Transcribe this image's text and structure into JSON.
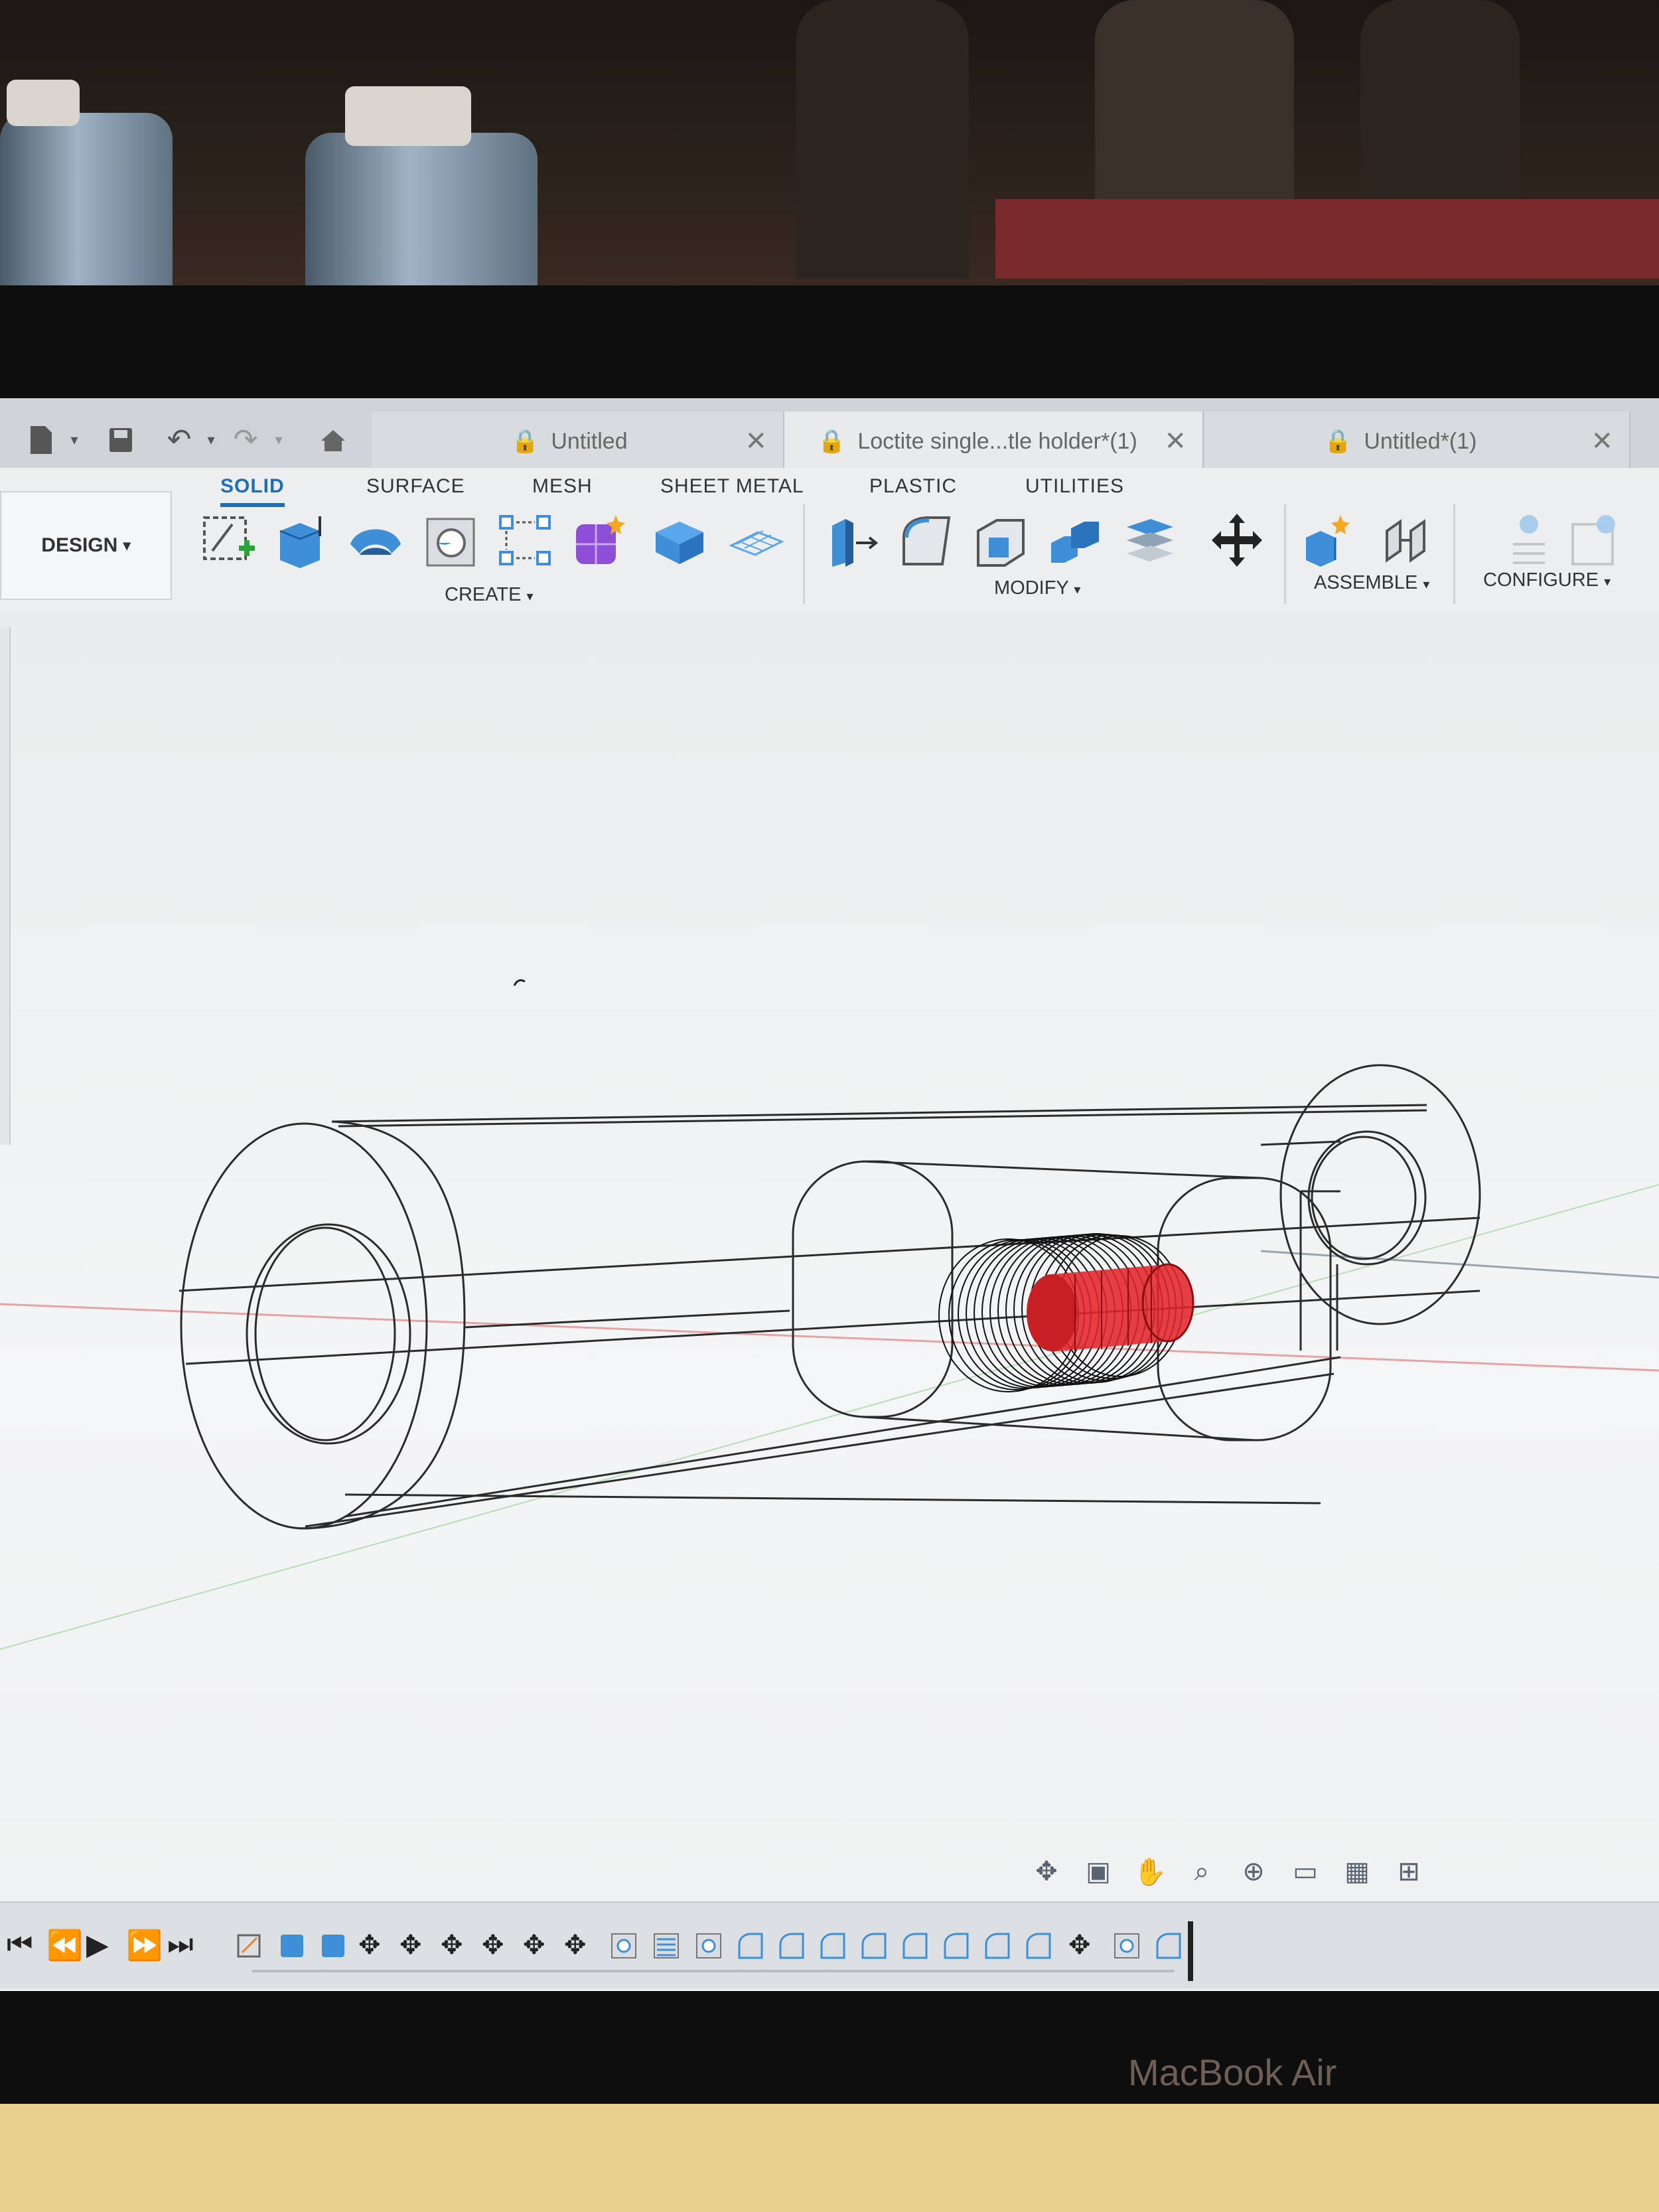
{
  "tabs": [
    {
      "label": "Untitled",
      "active": false
    },
    {
      "label": "Loctite single...tle holder*(1)",
      "active": true
    },
    {
      "label": "Untitled*(1)",
      "active": false
    }
  ],
  "workspace": {
    "label": "DESIGN"
  },
  "ribbon_tabs": [
    {
      "label": "SOLID",
      "active": true
    },
    {
      "label": "SURFACE"
    },
    {
      "label": "MESH"
    },
    {
      "label": "SHEET METAL"
    },
    {
      "label": "PLASTIC"
    },
    {
      "label": "UTILITIES"
    }
  ],
  "groups": {
    "create": "CREATE",
    "modify": "MODIFY",
    "assemble": "ASSEMBLE",
    "configure": "CONFIGURE"
  },
  "brand": "MacBook Air",
  "colors": {
    "accent": "#1f6fb8",
    "body_highlight": "#e0262b",
    "tool_blue": "#3f8fd8",
    "tool_purple": "#8e4fd6"
  },
  "nav_icons": [
    "orbit-icon",
    "look-at-icon",
    "pan-icon",
    "zoom-icon",
    "fit-icon",
    "display-icon",
    "grid-icon",
    "viewport-icon"
  ]
}
